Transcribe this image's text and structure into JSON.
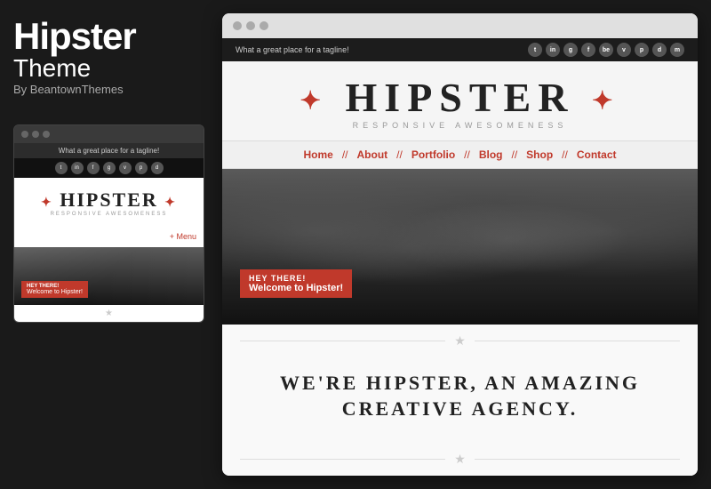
{
  "leftPanel": {
    "themeName": "Hipster",
    "themeSub": "Theme",
    "author": "By BeantownThemes",
    "miniBrowser": {
      "tagline": "What a great place for a tagline!",
      "logoText": "HIPSTER",
      "logoSub": "RESPONSIVE AWESOMENESS",
      "menuButton": "+ Menu",
      "heroBadgeTop": "HEY THERE!",
      "heroBadgeBottom": "Welcome to Hipster!"
    }
  },
  "rightPanel": {
    "browserDots": [
      "dot1",
      "dot2",
      "dot3"
    ],
    "topbar": {
      "tagline": "What a great place for a tagline!",
      "socialIcons": [
        "t",
        "in",
        "g+",
        "f",
        "be",
        "v",
        "p",
        "d",
        "m"
      ]
    },
    "logo": {
      "text": "HIPSTER",
      "subtext": "RESPONSIVE AWESOMENESS"
    },
    "nav": {
      "items": [
        "Home",
        "About",
        "Portfolio",
        "Blog",
        "Shop",
        "Contact"
      ]
    },
    "hero": {
      "badgeTop": "HEY THERE!",
      "badgeBottom": "Welcome to Hipster!"
    },
    "taglineSection": {
      "line1": "WE'RE HIPSTER, AN AMAZING",
      "line2": "CREATIVE AGENCY."
    }
  },
  "icons": {
    "windowDot": "●",
    "star": "★",
    "separator": "//",
    "plus": "+"
  }
}
